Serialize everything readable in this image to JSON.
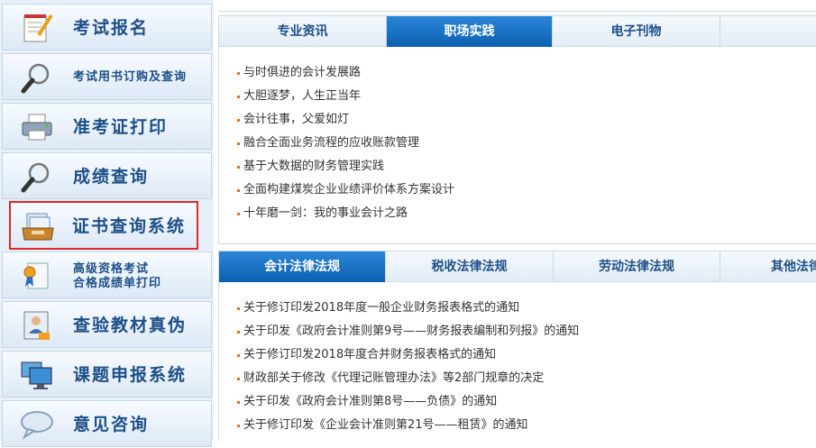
{
  "sidebar": {
    "items": [
      {
        "label": "考试报名",
        "icon": "notepad-pencil-icon"
      },
      {
        "label": "考试用书订购及查询",
        "icon": "magnifier-icon"
      },
      {
        "label": "准考证打印",
        "icon": "printer-icon"
      },
      {
        "label": "成绩查询",
        "icon": "magnifier-icon"
      },
      {
        "label": "证书查询系统",
        "icon": "certificate-tray-icon"
      },
      {
        "label_line1": "高级资格考试",
        "label_line2": "合格成绩单打印",
        "icon": "certificate-ribbon-icon"
      },
      {
        "label": "查验教材真伪",
        "icon": "id-card-icon"
      },
      {
        "label": "课题申报系统",
        "icon": "monitor-icon"
      },
      {
        "label": "意见咨询",
        "icon": "speech-bubble-icon"
      }
    ]
  },
  "news_panel": {
    "tabs": [
      "专业资讯",
      "职场实践",
      "电子刊物"
    ],
    "active_tab": 1,
    "items": [
      "与时俱进的会计发展路",
      "大胆逐梦，人生正当年",
      "会计往事，父爱如灯",
      "融合全面业务流程的应收账款管理",
      "基于大数据的财务管理实践",
      "全面构建煤炭企业业绩评价体系方案设计",
      "十年磨一剑：我的事业会计之路"
    ]
  },
  "law_panel": {
    "tabs": [
      "会计法律法规",
      "税收法律法规",
      "劳动法律法规",
      "其他法律法规"
    ],
    "active_tab": 0,
    "items": [
      "关于修订印发2018年度一般企业财务报表格式的通知",
      "关于印发《政府会计准则第9号——财务报表编制和列报》的通知",
      "关于修订印发2018年度合并财务报表格式的通知",
      "财政部关于修改《代理记账管理办法》等2部门规章的决定",
      "关于印发《政府会计准则第8号——负债》的通知",
      "关于修订印发《企业会计准则第21号——租赁》的通知"
    ]
  },
  "colors": {
    "accent": "#0d5fae",
    "highlight_border": "#e0282c",
    "bullet": "#e36c1c",
    "label": "#1d4f87"
  }
}
